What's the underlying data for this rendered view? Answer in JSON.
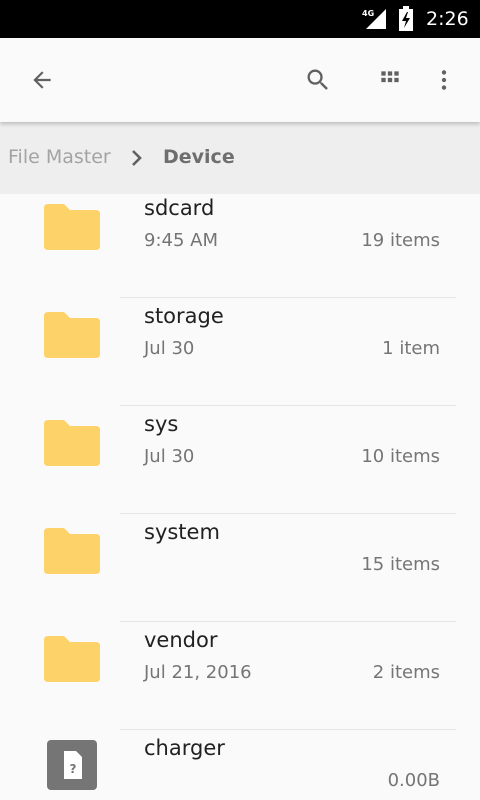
{
  "status_bar": {
    "network": "4G",
    "time": "2:26"
  },
  "toolbar": {
    "back_icon": "arrow-left-icon",
    "search_icon": "search-icon",
    "view_icon": "grid-view-icon",
    "more_icon": "more-vert-icon"
  },
  "breadcrumb": {
    "root": "File Master",
    "current": "Device"
  },
  "colors": {
    "folder": "#fdd268",
    "file_badge": "#757575"
  },
  "files": [
    {
      "name": "sdcard",
      "date": "9:45 AM",
      "count": "19 items",
      "type": "folder"
    },
    {
      "name": "storage",
      "date": "Jul 30",
      "count": "1 item",
      "type": "folder"
    },
    {
      "name": "sys",
      "date": "Jul 30",
      "count": "10 items",
      "type": "folder"
    },
    {
      "name": "system",
      "date": "",
      "count": "15 items",
      "type": "folder"
    },
    {
      "name": "vendor",
      "date": "Jul 21, 2016",
      "count": "2 items",
      "type": "folder"
    },
    {
      "name": "charger",
      "date": "",
      "count": "0.00B",
      "type": "file"
    }
  ]
}
